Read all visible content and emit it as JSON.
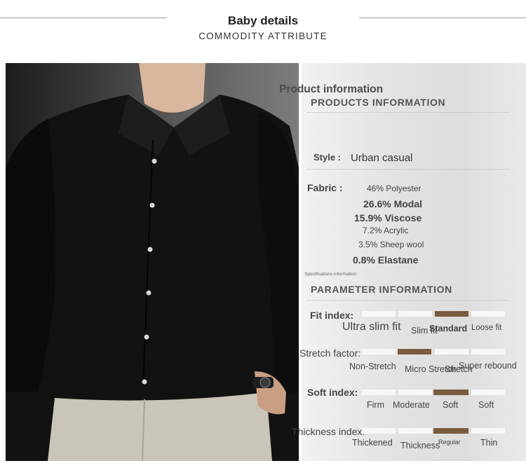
{
  "header": {
    "title": "Baby details",
    "subtitle": "COMMODITY ATTRIBUTE"
  },
  "colors": {
    "accent_bar": "#7a5c3f",
    "shirt": "#111111",
    "pants": "#c9c5b9",
    "panel_bg": "#e4e4e4"
  },
  "product_info": {
    "heading": "Product information",
    "heading_en": "PRODUCTS INFORMATION",
    "style_label": "Style :",
    "style_value": "Urban casual",
    "fabric_label": "Fabric :",
    "fabric": [
      "46% Polyester",
      "26.6% Modal",
      "15.9% Viscose",
      "7.2% Acrylic",
      "3.5% Sheep wool",
      "0.8% Elastane"
    ]
  },
  "parameters": {
    "heading": "Specifications information",
    "heading_en": "PARAMETER INFORMATION",
    "fit": {
      "label": "Fit index:",
      "options": [
        "Ultra slim fit",
        "Slim fit",
        "Standard",
        "Loose fit"
      ],
      "selected": 2
    },
    "stretch": {
      "label": "Stretch factor:",
      "options": [
        "Non-Stretch",
        "Micro Stretch",
        "Stretch",
        "Super rebound"
      ],
      "selected": 1
    },
    "soft": {
      "label": "Soft index:",
      "options": [
        "Firm",
        "Moderate",
        "Soft",
        "Soft"
      ],
      "selected": 2
    },
    "thickness": {
      "label": "Thickness index:",
      "options": [
        "Thickened",
        "Thickness",
        "Regular",
        "Thin"
      ],
      "selected": 2
    }
  }
}
